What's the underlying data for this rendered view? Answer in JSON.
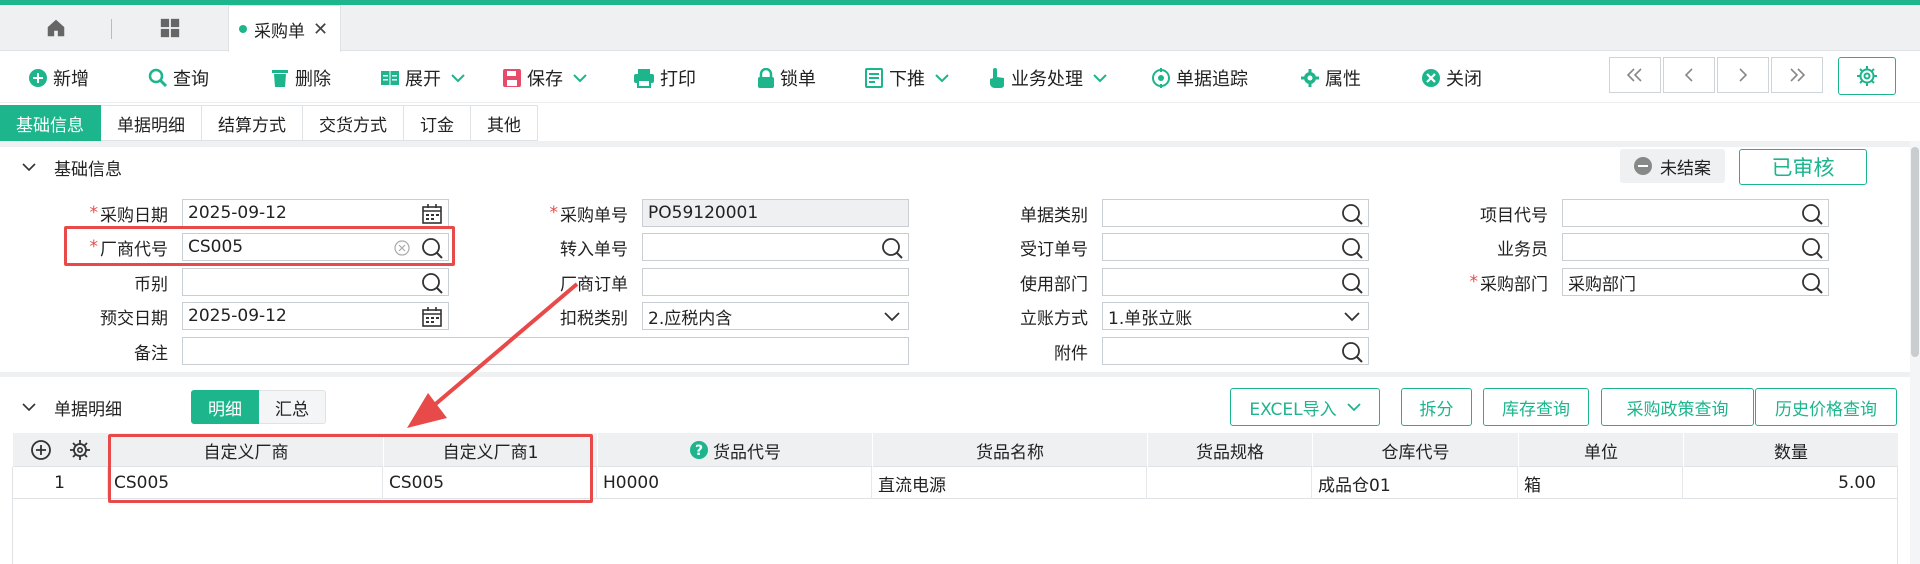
{
  "tabs": {
    "active_doc": "采购单"
  },
  "toolbar": {
    "add": "新增",
    "query": "查询",
    "delete": "删除",
    "expand": "展开",
    "save": "保存",
    "print": "打印",
    "lock": "锁单",
    "push_down": "下推",
    "business": "业务处理",
    "track": "单据追踪",
    "props": "属性",
    "close": "关闭"
  },
  "section_tabs": [
    "基础信息",
    "单据明细",
    "结算方式",
    "交货方式",
    "订金",
    "其他"
  ],
  "basic": {
    "title": "基础信息",
    "status_pending": "未结案",
    "status_audited": "已审核",
    "labels": {
      "purchase_date": "采购日期",
      "vendor_code": "厂商代号",
      "currency": "币别",
      "delivery_date": "预交日期",
      "remark": "备注",
      "po_no": "采购单号",
      "transfer_no": "转入单号",
      "vendor_order": "厂商订单",
      "tax_type": "扣税类别",
      "doc_type": "单据类别",
      "order_no": "受订单号",
      "use_dept": "使用部门",
      "account_mode": "立账方式",
      "attachment": "附件",
      "project_code": "项目代号",
      "salesman": "业务员",
      "purchase_dept": "采购部门"
    },
    "values": {
      "purchase_date": "2025-09-12",
      "vendor_code": "CS005",
      "currency": "",
      "delivery_date": "2025-09-12",
      "remark": "",
      "po_no": "PO59120001",
      "transfer_no": "",
      "vendor_order": "",
      "tax_type": "2.应税内含",
      "doc_type": "",
      "order_no": "",
      "use_dept": "",
      "account_mode": "1.单张立账",
      "attachment": "",
      "project_code": "",
      "salesman": "",
      "purchase_dept": "采购部门"
    }
  },
  "detail": {
    "title": "单据明细",
    "seg_detail": "明细",
    "seg_summary": "汇总",
    "buttons": {
      "excel": "EXCEL导入",
      "split": "拆分",
      "stock": "库存查询",
      "policy": "采购政策查询",
      "history": "历史价格查询"
    },
    "columns": [
      "自定义厂商",
      "自定义厂商1",
      "货品代号",
      "货品名称",
      "货品规格",
      "仓库代号",
      "单位",
      "数量"
    ],
    "rows": [
      {
        "no": "1",
        "c1": "CS005",
        "c2": "CS005",
        "code": "H0000",
        "name": "直流电源",
        "spec": "",
        "wh": "成品仓01",
        "unit": "箱",
        "qty": "5.00"
      }
    ]
  },
  "colors": {
    "accent": "#1db58c",
    "highlight": "#e84a4a"
  }
}
